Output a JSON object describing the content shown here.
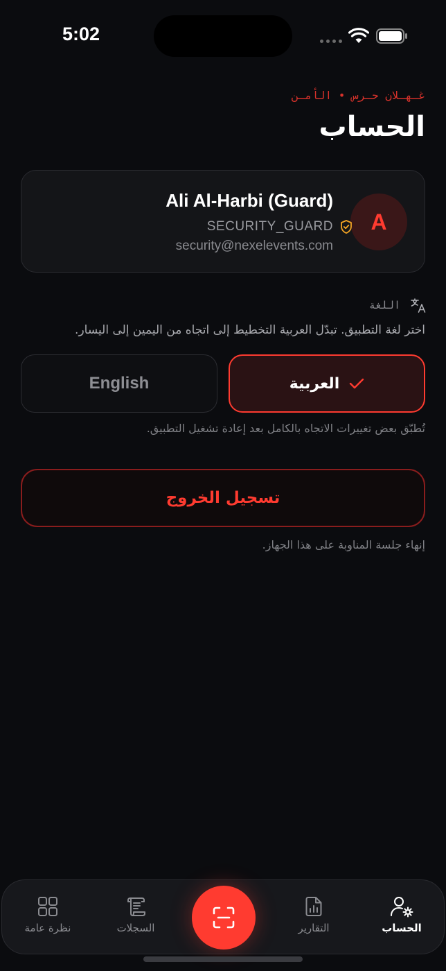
{
  "status_bar": {
    "time": "5:02"
  },
  "header": {
    "subtitle": "غـهـلان حـرس • الأمـن",
    "title": "الحساب"
  },
  "profile": {
    "avatar_letter": "A",
    "name": "Ali Al-Harbi (Guard)",
    "role": "SECURITY_GUARD",
    "email": "security@nexelevents.com"
  },
  "language": {
    "label": "اللغة",
    "description": "اختر لغة التطبيق. تبدّل العربية التخطيط إلى اتجاه من اليمين إلى اليسار.",
    "arabic_label": "العربية",
    "english_label": "English",
    "selected": "arabic",
    "restart_note": "تُطبّق بعض تغييرات الاتجاه بالكامل بعد إعادة تشغيل التطبيق."
  },
  "logout": {
    "label": "تسجيل الخروج",
    "note": "إنهاء جلسة المناوبة على هذا الجهاز."
  },
  "tabs": {
    "overview": "نظرة عامة",
    "logs": "السجلات",
    "reports": "التقارير",
    "account": "الحساب",
    "active": "account"
  },
  "colors": {
    "accent": "#ff3b30",
    "background": "#0b0c0f",
    "badge": "#f5a524"
  }
}
